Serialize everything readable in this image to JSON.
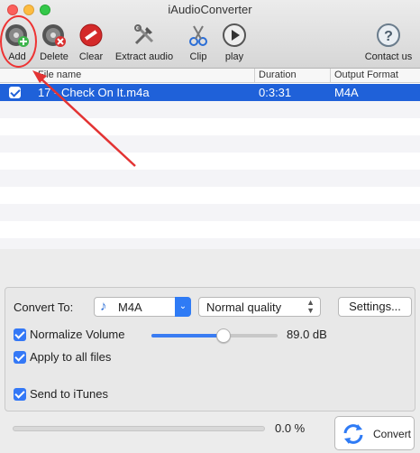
{
  "window": {
    "title": "iAudioConverter"
  },
  "toolbar": {
    "add": "Add",
    "delete": "Delete",
    "clear": "Clear",
    "extract_audio": "Extract audio",
    "clip": "Clip",
    "play": "play",
    "contact": "Contact us"
  },
  "list": {
    "columns": [
      "File name",
      "Duration",
      "Output Format"
    ],
    "rows": [
      {
        "checked": true,
        "file_name": "17 - Check On It.m4a",
        "duration": "0:3:31",
        "format": "M4A"
      }
    ]
  },
  "settings": {
    "convert_to_label": "Convert To:",
    "format_value": "M4A",
    "quality_value": "Normal quality",
    "settings_button": "Settings...",
    "normalize_label": "Normalize Volume",
    "normalize_checked": true,
    "volume_level": 0.57,
    "volume_value": "89.0 dB",
    "apply_all_label": "Apply to all files",
    "apply_all_checked": true
  },
  "itunes": {
    "label": "Send to iTunes",
    "checked": true
  },
  "progress": {
    "value": 0.0,
    "text": "0.0 %"
  },
  "convert_button": "Convert",
  "colors": {
    "selection": "#1f61d9",
    "accent": "#3478f6",
    "annotation": "#e33333"
  }
}
